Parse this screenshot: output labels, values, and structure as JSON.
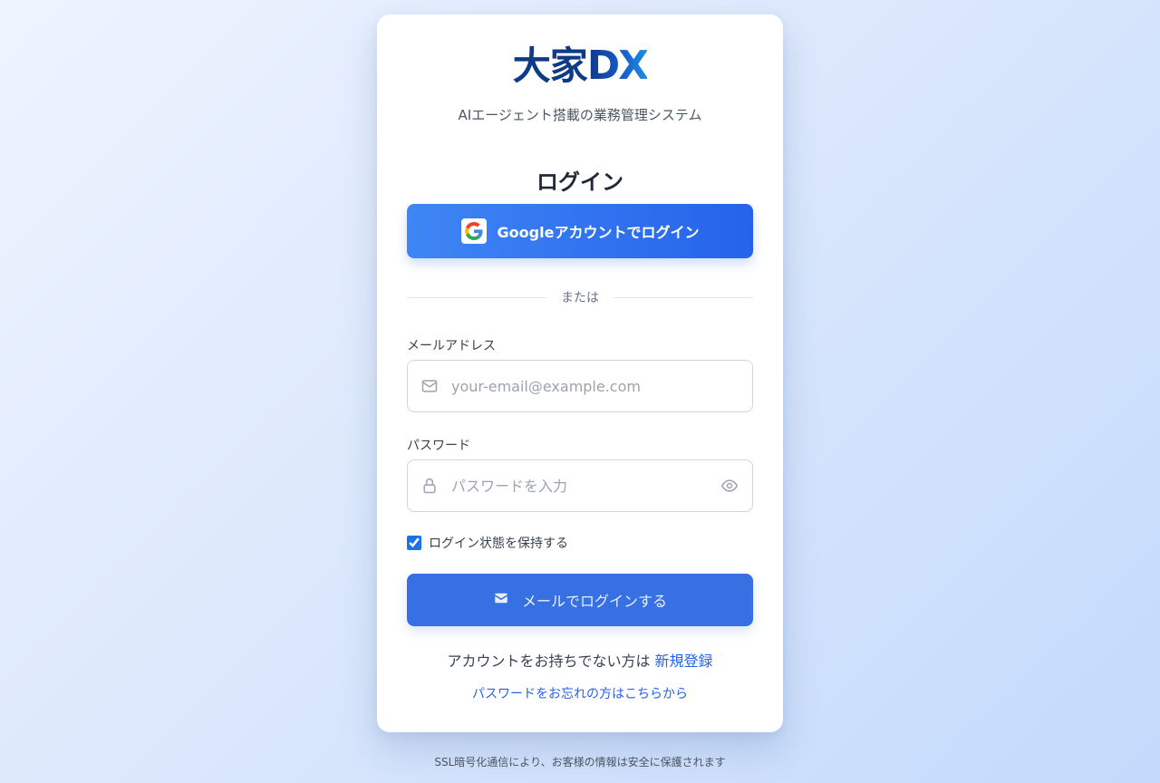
{
  "logo": {
    "kanji": "大家",
    "dx": "DX"
  },
  "subtitle": "AIエージェント搭載の業務管理システム",
  "heading": "ログイン",
  "google_button": {
    "label": "Googleアカウントでログイン"
  },
  "divider_text": "または",
  "email": {
    "label": "メールアドレス",
    "placeholder": "your-email@example.com",
    "value": ""
  },
  "password": {
    "label": "パスワード",
    "placeholder": "パスワードを入力",
    "value": ""
  },
  "remember": {
    "label": "ログイン状態を保持する",
    "checked": true
  },
  "submit_button": {
    "label": "メールでログインする"
  },
  "signup": {
    "text": "アカウントをお持ちでない方は",
    "link": "新規登録"
  },
  "forgot_link": "パスワードをお忘れの方はこちらから",
  "footer": "SSL暗号化通信により、お客様の情報は安全に保護されます",
  "colors": {
    "primary": "#2563eb",
    "google_gradient_start": "#3f86f4",
    "submit_button": "#3670e3",
    "logo_navy": "#0f3a87"
  },
  "icons": {
    "google": "google-logo-icon",
    "email": "mail-icon",
    "password": "lock-icon",
    "visibility": "eye-icon",
    "submit": "envelope-icon"
  }
}
